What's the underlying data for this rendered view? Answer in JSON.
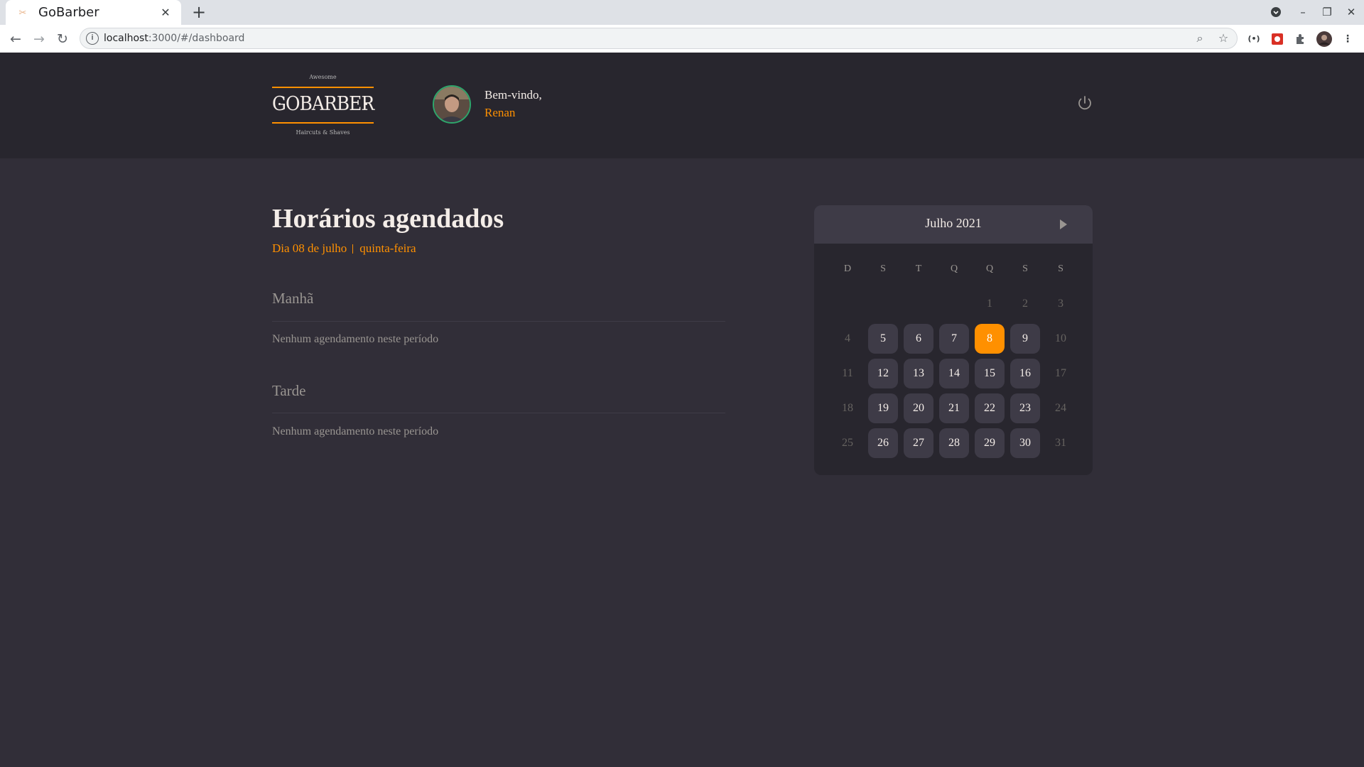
{
  "browser": {
    "tab_title": "GoBarber",
    "url_host": "localhost",
    "url_rest": ":3000/#/dashboard"
  },
  "header": {
    "logo": {
      "top": "Awesome",
      "main": "GOBARBER",
      "bottom": "Haircuts & Shaves"
    },
    "welcome": "Bem-vindo,",
    "user_name": "Renan"
  },
  "schedule": {
    "title": "Horários agendados",
    "day_label": "Dia 08 de julho",
    "weekday_label": "quinta-feira",
    "sections": [
      {
        "title": "Manhã",
        "empty_message": "Nenhum agendamento neste período"
      },
      {
        "title": "Tarde",
        "empty_message": "Nenhum agendamento neste período"
      }
    ]
  },
  "calendar": {
    "caption": "Julho 2021",
    "weekdays": [
      "D",
      "S",
      "T",
      "Q",
      "Q",
      "S",
      "S"
    ],
    "weeks": [
      [
        null,
        null,
        null,
        null,
        {
          "d": "1",
          "s": "muted"
        },
        {
          "d": "2",
          "s": "muted"
        },
        {
          "d": "3",
          "s": "muted"
        }
      ],
      [
        {
          "d": "4",
          "s": "muted"
        },
        {
          "d": "5",
          "s": "avail"
        },
        {
          "d": "6",
          "s": "avail"
        },
        {
          "d": "7",
          "s": "avail"
        },
        {
          "d": "8",
          "s": "selected"
        },
        {
          "d": "9",
          "s": "avail"
        },
        {
          "d": "10",
          "s": "muted"
        }
      ],
      [
        {
          "d": "11",
          "s": "muted"
        },
        {
          "d": "12",
          "s": "avail"
        },
        {
          "d": "13",
          "s": "avail"
        },
        {
          "d": "14",
          "s": "avail"
        },
        {
          "d": "15",
          "s": "avail"
        },
        {
          "d": "16",
          "s": "avail"
        },
        {
          "d": "17",
          "s": "muted"
        }
      ],
      [
        {
          "d": "18",
          "s": "muted"
        },
        {
          "d": "19",
          "s": "avail"
        },
        {
          "d": "20",
          "s": "avail"
        },
        {
          "d": "21",
          "s": "avail"
        },
        {
          "d": "22",
          "s": "avail"
        },
        {
          "d": "23",
          "s": "avail"
        },
        {
          "d": "24",
          "s": "muted"
        }
      ],
      [
        {
          "d": "25",
          "s": "muted"
        },
        {
          "d": "26",
          "s": "avail"
        },
        {
          "d": "27",
          "s": "avail"
        },
        {
          "d": "28",
          "s": "avail"
        },
        {
          "d": "29",
          "s": "avail"
        },
        {
          "d": "30",
          "s": "avail"
        },
        {
          "d": "31",
          "s": "muted"
        }
      ]
    ]
  },
  "colors": {
    "accent": "#ff9000",
    "background": "#312e38",
    "header_bg": "#28262e",
    "card": "#3e3b47",
    "text": "#f4ede8",
    "muted_text": "#999591"
  },
  "icons": {
    "power": "power-icon",
    "next_month": "arrow-right-icon"
  }
}
